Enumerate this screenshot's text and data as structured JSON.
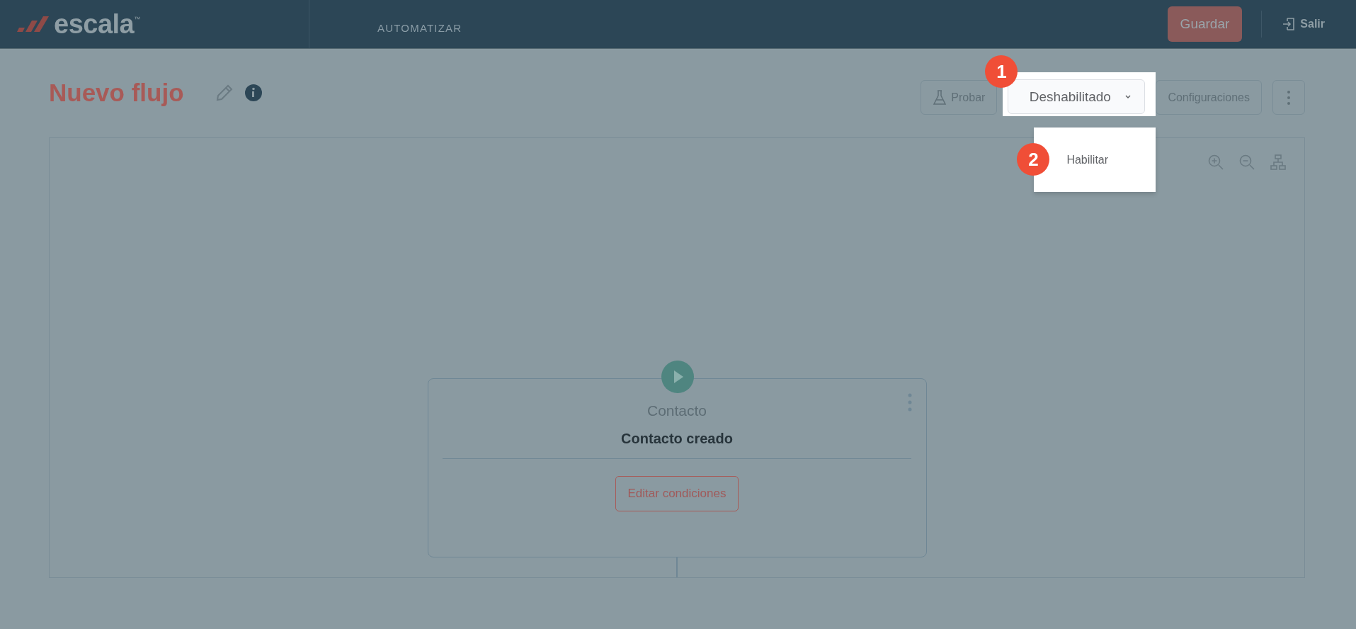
{
  "header": {
    "logo": "escala",
    "logo_mark": "™",
    "section": "AUTOMATIZAR",
    "save_button": "Guardar",
    "logout": "Salir"
  },
  "flow": {
    "title": "Nuevo flujo"
  },
  "toolbar": {
    "test_button": "Probar",
    "status_dropdown": "Deshabilitado",
    "settings_button": "Configuraciones"
  },
  "status_menu": {
    "items": [
      "Habilitar"
    ]
  },
  "canvas": {
    "nodes": [
      {
        "category": "Contacto",
        "title": "Contacto creado",
        "action": "Editar condiciones"
      }
    ]
  },
  "steps": [
    {
      "number": "1"
    },
    {
      "number": "2"
    }
  ]
}
